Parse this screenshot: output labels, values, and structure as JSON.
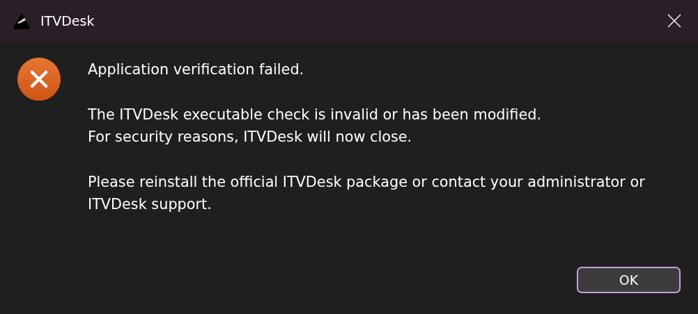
{
  "window": {
    "title": "ITVDesk"
  },
  "message": {
    "kind": "error",
    "paragraphs": [
      [
        "Application verification failed."
      ],
      [
        "The ITVDesk executable check is invalid or has been modified.",
        "For security reasons, ITVDesk will now close."
      ],
      [
        "Please reinstall the official ITVDesk package or contact your administrator or ITVDesk support."
      ]
    ]
  },
  "buttons": [
    {
      "label": "OK",
      "default": true
    }
  ]
}
